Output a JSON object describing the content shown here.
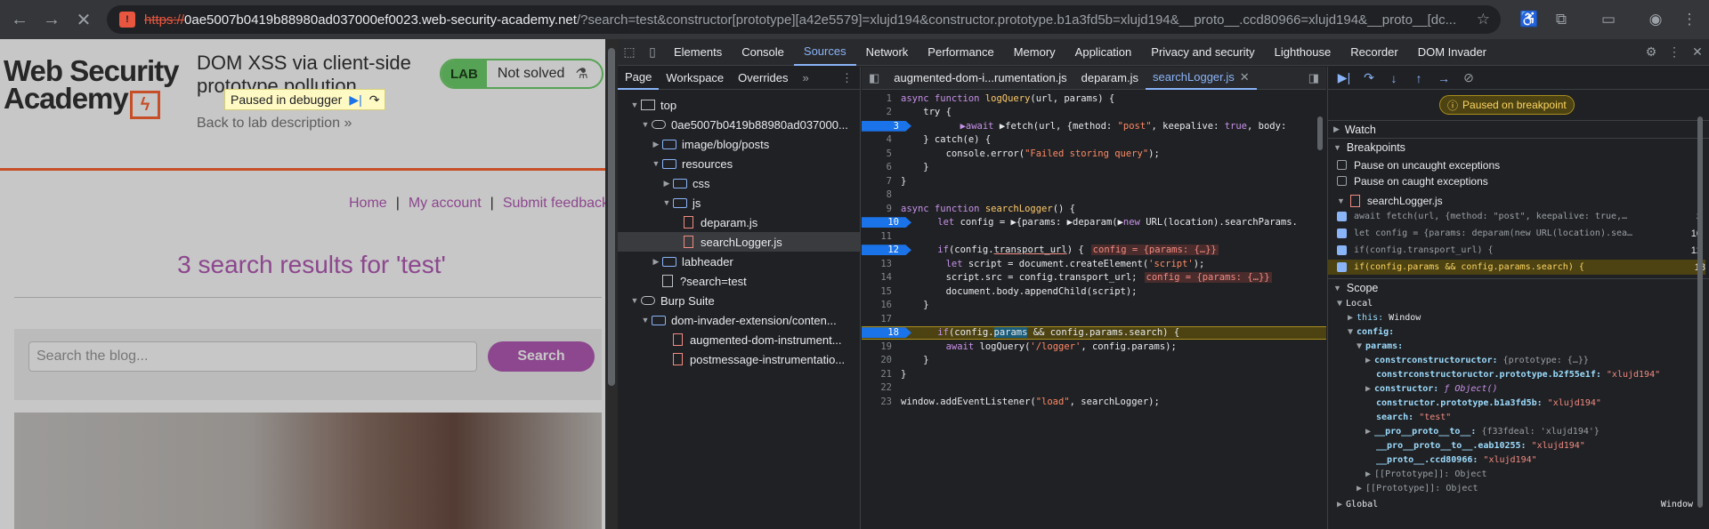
{
  "browser": {
    "url_proto": "https://",
    "url_host": "0ae5007b0419b88980ad037000ef0023.web-security-academy.net",
    "url_rest": "/?search=test&constructor[prototype][a42e5579]=xlujd194&constructor.prototype.b1a3fd5b=xlujd194&__proto__.ccd80966=xlujd194&__proto__[dc..."
  },
  "webpage": {
    "logo_line1": "Web Security",
    "logo_line2": "Academy",
    "lab_title": "DOM XSS via client-side prototype pollution",
    "back_link": "Back to lab description",
    "lab_label": "LAB",
    "lab_status": "Not solved",
    "paused_text": "Paused in debugger",
    "nav": {
      "home": "Home",
      "account": "My account",
      "feedback": "Submit feedback"
    },
    "results_title": "3 search results for 'test'",
    "search_placeholder": "Search the blog...",
    "search_button": "Search"
  },
  "devtools": {
    "tabs": [
      "Elements",
      "Console",
      "Sources",
      "Network",
      "Performance",
      "Memory",
      "Application",
      "Privacy and security",
      "Lighthouse",
      "Recorder",
      "DOM Invader"
    ],
    "active_tab": "Sources",
    "nav_subtabs": [
      "Page",
      "Workspace",
      "Overrides"
    ],
    "tree": {
      "top": "top",
      "origin": "0ae5007b0419b88980ad037000...",
      "blog_posts": "image/blog/posts",
      "resources": "resources",
      "css": "css",
      "js": "js",
      "deparam": "deparam.js",
      "searchlogger": "searchLogger.js",
      "labheader": "labheader",
      "query": "?search=test",
      "burp": "Burp Suite",
      "ext": "dom-invader-extension/conten...",
      "augmented": "augmented-dom-instrument...",
      "postmessage": "postmessage-instrumentatio..."
    },
    "editor_tabs": [
      "augmented-dom-i...rumentation.js",
      "deparam.js",
      "searchLogger.js"
    ],
    "code": {
      "l1": "async function logQuery(url, params) {",
      "l2": "    try {",
      "l3": "        await fetch(url, {method: \"post\", keepalive: true, body: ",
      "l4": "    } catch(e) {",
      "l5": "        console.error(\"Failed storing query\");",
      "l6": "    }",
      "l7": "}",
      "l8": "",
      "l9": "async function searchLogger() {",
      "l10": "    let config = {params: deparam(new URL(location).searchParams.",
      "l11": "",
      "l12": "    if(config.transport_url) {",
      "l12v": "config = {params: {…}}",
      "l13": "        let script = document.createElement('script');",
      "l14": "        script.src = config.transport_url;",
      "l14v": "config = {params: {…}}",
      "l15": "        document.body.appendChild(script);",
      "l16": "    }",
      "l17": "",
      "l18": "    if(config.params && config.params.search) {",
      "l19": "        await logQuery('/logger', config.params);",
      "l20": "    }",
      "l21": "}",
      "l22": "",
      "l23": "window.addEventListener(\"load\", searchLogger);"
    },
    "debugger": {
      "paused_banner": "Paused on breakpoint",
      "watch": "Watch",
      "breakpoints": "Breakpoints",
      "uncaught": "Pause on uncaught exceptions",
      "caught": "Pause on caught exceptions",
      "file": "searchLogger.js",
      "bp1_code": "await fetch(url, {method: \"post\", keepalive: true,…",
      "bp1_line": "3",
      "bp2_code": "let config = {params: deparam(new URL(location).sea…",
      "bp2_line": "10",
      "bp3_code": "if(config.transport_url) {",
      "bp3_line": "12",
      "bp4_code": "if(config.params && config.params.search) {",
      "bp4_line": "18",
      "scope": "Scope",
      "local": "Local",
      "this_key": "this:",
      "this_val": "Window",
      "config_key": "config:",
      "params_key": "params:",
      "s1_key": "constrconstructoructor:",
      "s1_val": "{prototype: {…}}",
      "s2_key": "constrconstructoructor.prototype.b2f55e1f:",
      "s2_val": "\"xlujd194\"",
      "s3_key": "constructor:",
      "s3_val": "ƒ Object()",
      "s4_key": "constructor.prototype.b1a3fd5b:",
      "s4_val": "\"xlujd194\"",
      "s5_key": "search:",
      "s5_val": "\"test\"",
      "s6_key": "__pro__proto__to__:",
      "s6_val": "{f33fdeal: 'xlujd194'}",
      "s7_key": "__pro__proto__to__.eab10255:",
      "s7_val": "\"xlujd194\"",
      "s8_key": "__proto__.ccd80966:",
      "s8_val": "\"xlujd194\"",
      "proto1": "[[Prototype]]: Object",
      "proto2": "[[Prototype]]: Object",
      "global": "Global",
      "global_val": "Window"
    }
  }
}
